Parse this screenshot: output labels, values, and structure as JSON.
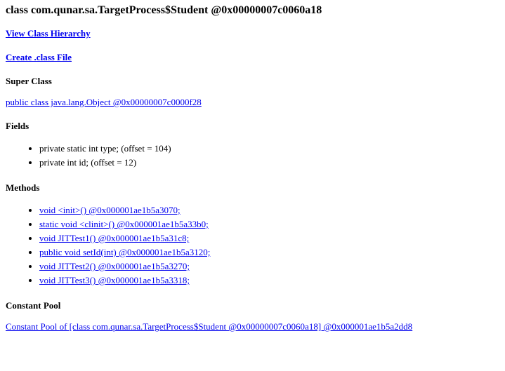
{
  "title": "class com.qunar.sa.TargetProcess$Student @0x00000007c0060a18",
  "nav": {
    "view_hierarchy": "View Class Hierarchy",
    "create_class_file": "Create .class File"
  },
  "sections": {
    "super_class": "Super Class",
    "fields": "Fields",
    "methods": "Methods",
    "constant_pool": "Constant Pool"
  },
  "super_class_link": "public class java.lang.Object @0x00000007c0000f28",
  "fields": [
    "private static int type; (offset = 104)",
    "private int id; (offset = 12)"
  ],
  "methods": [
    "void <init>() @0x000001ae1b5a3070;",
    "static void <clinit>() @0x000001ae1b5a33b0;",
    "void JITTest1() @0x000001ae1b5a31c8;",
    "public void setId(int) @0x000001ae1b5a3120;",
    "void JITTest2() @0x000001ae1b5a3270;",
    "void JITTest3() @0x000001ae1b5a3318;"
  ],
  "constant_pool_link": "Constant Pool of [class com.qunar.sa.TargetProcess$Student @0x00000007c0060a18] @0x000001ae1b5a2dd8"
}
